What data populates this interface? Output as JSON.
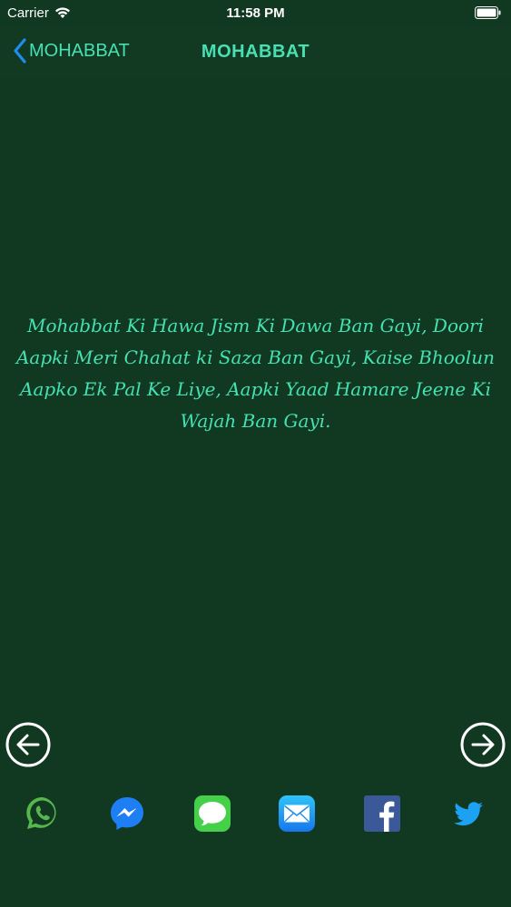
{
  "status_bar": {
    "carrier": "Carrier",
    "time": "11:58 PM"
  },
  "nav": {
    "back_label": "MOHABBAT",
    "title": "MOHABBAT"
  },
  "quote": {
    "text": "Mohabbat Ki Hawa Jism Ki Dawa Ban Gayi, Doori Aapki Meri Chahat ki Saza Ban Gayi, Kaise Bhoolun Aapko Ek Pal Ke Liye, Aapki Yaad Hamare Jeene Ki Wajah Ban Gayi."
  },
  "navigation_buttons": {
    "previous_icon": "arrow-left-circle",
    "next_icon": "arrow-right-circle"
  },
  "share": {
    "icons": [
      "whatsapp",
      "messenger",
      "messages",
      "mail",
      "facebook",
      "twitter"
    ]
  },
  "colors": {
    "background": "#113922",
    "accent": "#46e0b2",
    "whatsapp": "#57b64c",
    "messenger": "#1e7ff5",
    "messages": "#45d04a",
    "mail": "#1e9ef0",
    "facebook": "#3b5998",
    "twitter": "#1da1f2"
  }
}
